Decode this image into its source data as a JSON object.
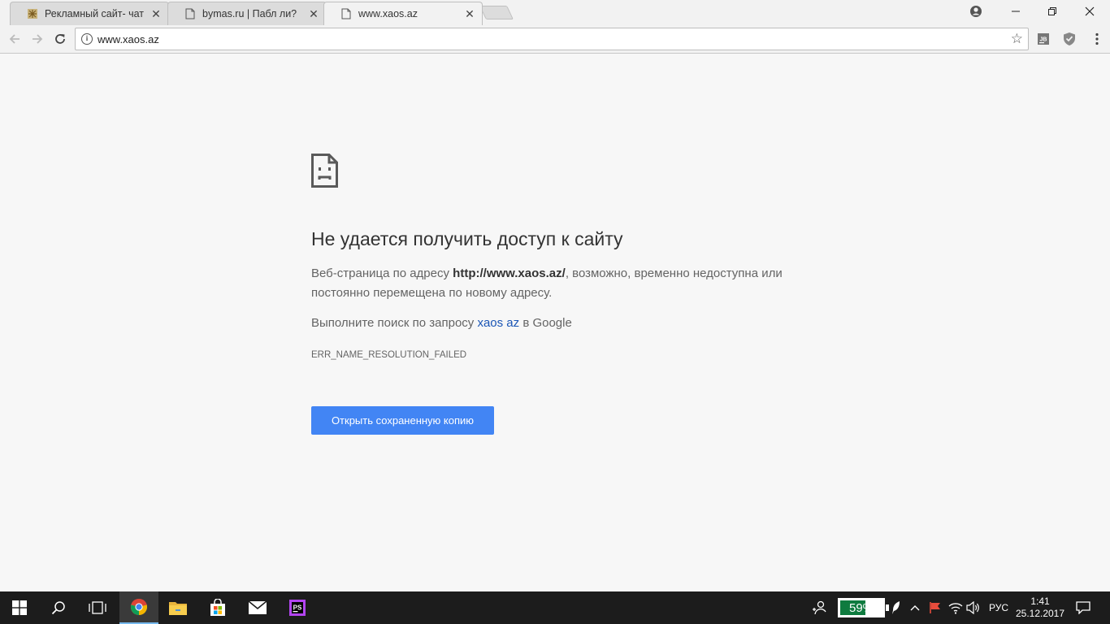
{
  "browser": {
    "tabs": [
      {
        "title": "Рекламный сайт- чат Vip",
        "favicon": "site-favicon-icon",
        "active": false
      },
      {
        "title": "bymas.ru | Пабл ли?",
        "favicon": "page-icon",
        "active": false
      },
      {
        "title": "www.xaos.az",
        "favicon": "page-icon",
        "active": true
      }
    ],
    "close_glyph": "✕",
    "omnibox": {
      "url": "www.xaos.az"
    },
    "extensions": [
      "jb-extension-icon",
      "shield-extension-icon"
    ],
    "ext_jb_label": "JB"
  },
  "error_page": {
    "icon": "sad-page-icon",
    "heading": "Не удается получить доступ к сайту",
    "desc_prefix": "Веб-страница по адресу ",
    "desc_url": "http://www.xaos.az/",
    "desc_suffix": ", возможно, временно недоступна или постоянно перемещена по новому адресу.",
    "suggest_prefix": "Выполните поиск по запросу ",
    "suggest_link": "xaos az",
    "suggest_suffix": " в Google",
    "error_code": "ERR_NAME_RESOLUTION_FAILED",
    "button_label": "Открыть сохраненную копию"
  },
  "taskbar": {
    "battery_percent": "59%",
    "battery_level": 0.59,
    "language": "РУС",
    "time": "1:41",
    "date": "25.12.2017"
  },
  "colors": {
    "button_blue": "#4285f4",
    "link_blue": "#1a55b5",
    "battery_green": "#0f7b3f"
  }
}
